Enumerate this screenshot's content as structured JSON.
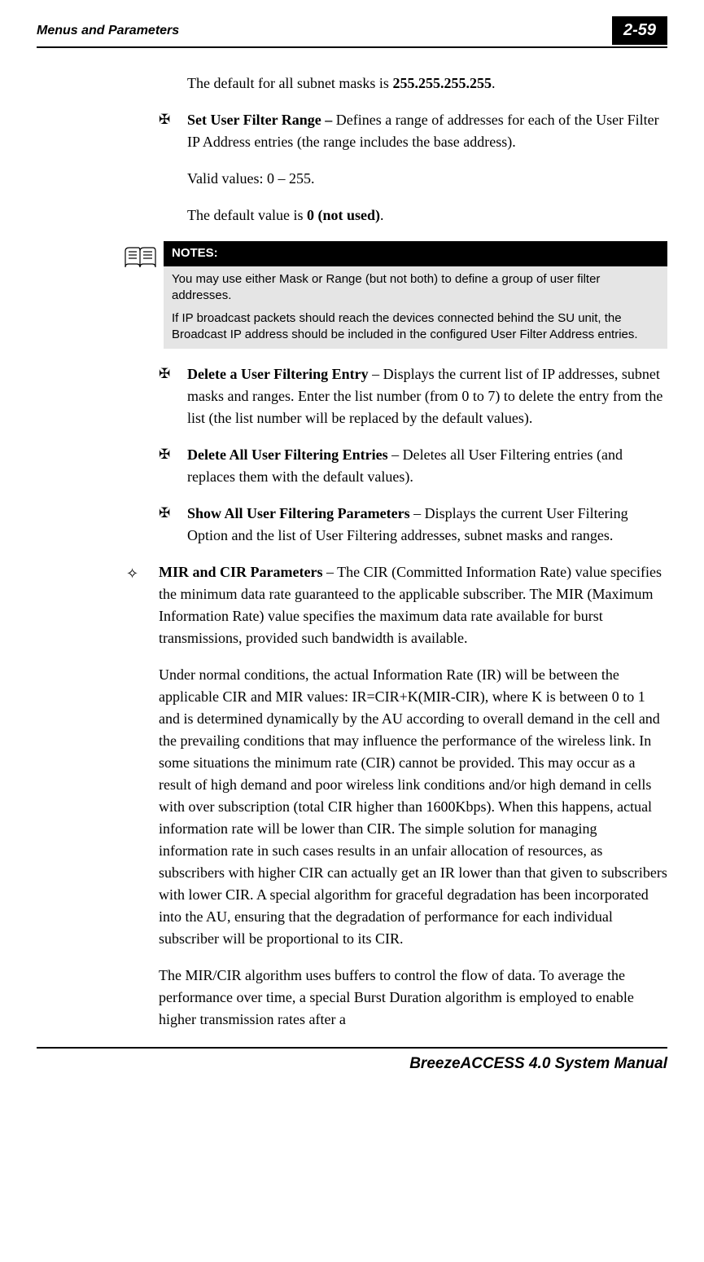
{
  "header": {
    "section": "Menus and Parameters",
    "page_number": "2-59"
  },
  "para_default_subnet": "The default for all subnet masks is ",
  "para_default_subnet_bold": "255.255.255.255",
  "para_default_subnet_end": ".",
  "bullet_set_user_filter": {
    "title": "Set User Filter Range – ",
    "text": "Defines a range of addresses for each of the User Filter IP Address entries (the range includes the base address).",
    "valid": "Valid values: 0 – 255.",
    "default_pre": "The default value is ",
    "default_bold": "0 (not used)",
    "default_end": "."
  },
  "notes": {
    "label": "NOTES:",
    "p1": "You may use either Mask or Range (but not both) to define a group of user filter addresses.",
    "p2": "If IP broadcast packets should reach the devices connected behind the SU unit, the Broadcast IP address should be included in the configured User Filter Address entries."
  },
  "bullet_delete_entry": {
    "title": "Delete a User Filtering Entry",
    "text": " – Displays the current list of IP addresses, subnet masks and ranges. Enter the list number (from 0 to 7) to delete the entry from the list (the list number will be replaced by the default values)."
  },
  "bullet_delete_all": {
    "title": "Delete All User Filtering Entries",
    "text": " – Deletes all User Filtering entries (and replaces them with the default values)."
  },
  "bullet_show_all": {
    "title": "Show All User Filtering Parameters",
    "text": " – Displays the current User Filtering Option and the list of User Filtering addresses, subnet masks and ranges."
  },
  "bullet_mir_cir": {
    "title": "MIR and CIR Parameters",
    "text": " – The CIR (Committed Information Rate) value specifies the minimum data rate guaranteed to the applicable subscriber. The MIR (Maximum Information Rate) value specifies the maximum data rate available for burst transmissions, provided such bandwidth is available.",
    "para2": "Under normal conditions, the actual Information Rate (IR) will be between the applicable CIR and MIR values: IR=CIR+K(MIR-CIR), where K is between 0 to 1 and is determined dynamically by the AU according to overall demand in the cell and the prevailing conditions that may influence the performance of the wireless link. In some situations the minimum rate (CIR) cannot be provided. This may occur as a result of high demand and poor wireless link conditions and/or high demand in cells with over subscription (total CIR higher than 1600Kbps). When this happens, actual information rate will be lower than CIR. The simple solution for managing information rate in such cases results in an unfair allocation of resources, as subscribers with higher CIR can actually get an IR lower than that given to subscribers with lower CIR. A special algorithm for graceful degradation has been incorporated into the AU, ensuring that the degradation of performance for each individual subscriber will be proportional to its CIR.",
    "para3": "The MIR/CIR algorithm uses buffers to control the flow of data. To average the performance over time, a special Burst Duration algorithm is employed to enable higher transmission rates after a"
  },
  "footer": {
    "manual_name": "BreezeACCESS 4.0 System Manual"
  }
}
